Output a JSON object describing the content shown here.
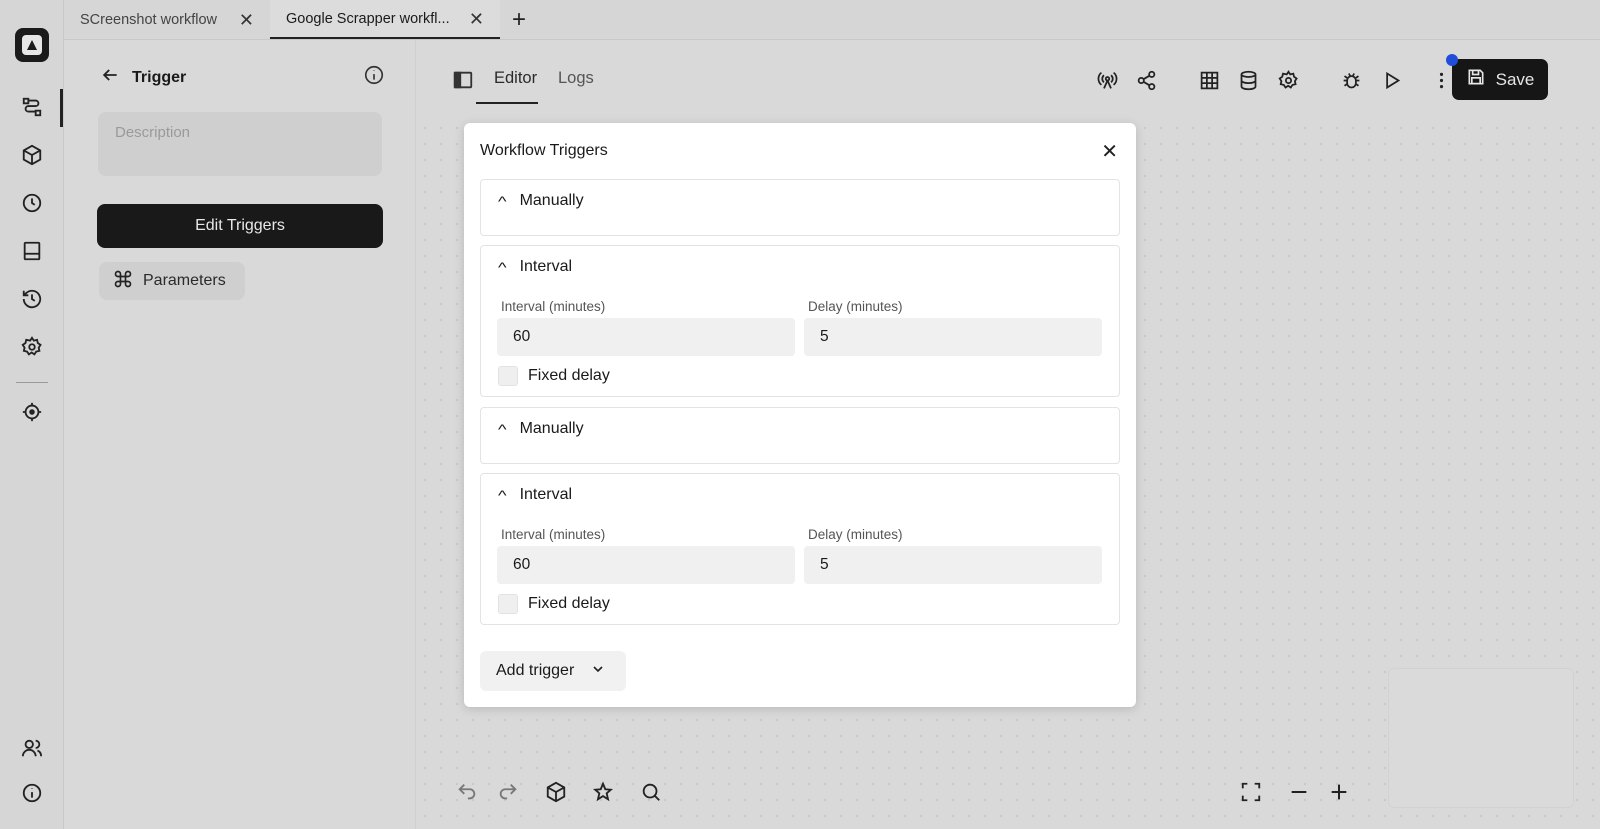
{
  "tabs": [
    {
      "label": "SCreenshot workflow",
      "active": false
    },
    {
      "label": "Google Scrapper workfl...",
      "active": true
    }
  ],
  "panel": {
    "title": "Trigger",
    "description_placeholder": "Description",
    "edit_triggers_label": "Edit Triggers",
    "parameters_label": "Parameters"
  },
  "editor": {
    "tab_editor": "Editor",
    "tab_logs": "Logs",
    "save_label": "Save"
  },
  "modal": {
    "title": "Workflow Triggers",
    "triggers": [
      {
        "type": "Manually"
      },
      {
        "type": "Interval",
        "interval_label": "Interval (minutes)",
        "interval_value": "60",
        "delay_label": "Delay (minutes)",
        "delay_value": "5",
        "fixed_delay_label": "Fixed delay"
      },
      {
        "type": "Manually"
      },
      {
        "type": "Interval",
        "interval_label": "Interval (minutes)",
        "interval_value": "60",
        "delay_label": "Delay (minutes)",
        "delay_value": "5",
        "fixed_delay_label": "Fixed delay"
      }
    ],
    "add_trigger_label": "Add trigger"
  },
  "colors": {
    "background": "#d9d9d9",
    "dark_button": "#191919",
    "accent_dot": "#1f4fd8",
    "modal_bg": "#ffffff"
  },
  "icons": {
    "rail": [
      "workflow-icon",
      "package-icon",
      "clock-icon",
      "layout-icon",
      "history-icon",
      "settings-icon",
      "crosshair-icon",
      "users-icon",
      "info-icon"
    ],
    "toolbar": [
      "broadcast-icon",
      "share-icon",
      "table-icon",
      "database-icon",
      "settings-icon",
      "bug-icon",
      "play-icon",
      "more-vertical-icon",
      "save-icon"
    ],
    "bottom": [
      "undo-icon",
      "redo-icon",
      "package-icon",
      "magic-icon",
      "search-icon",
      "fullscreen-icon",
      "zoom-out-icon",
      "zoom-in-icon"
    ]
  }
}
